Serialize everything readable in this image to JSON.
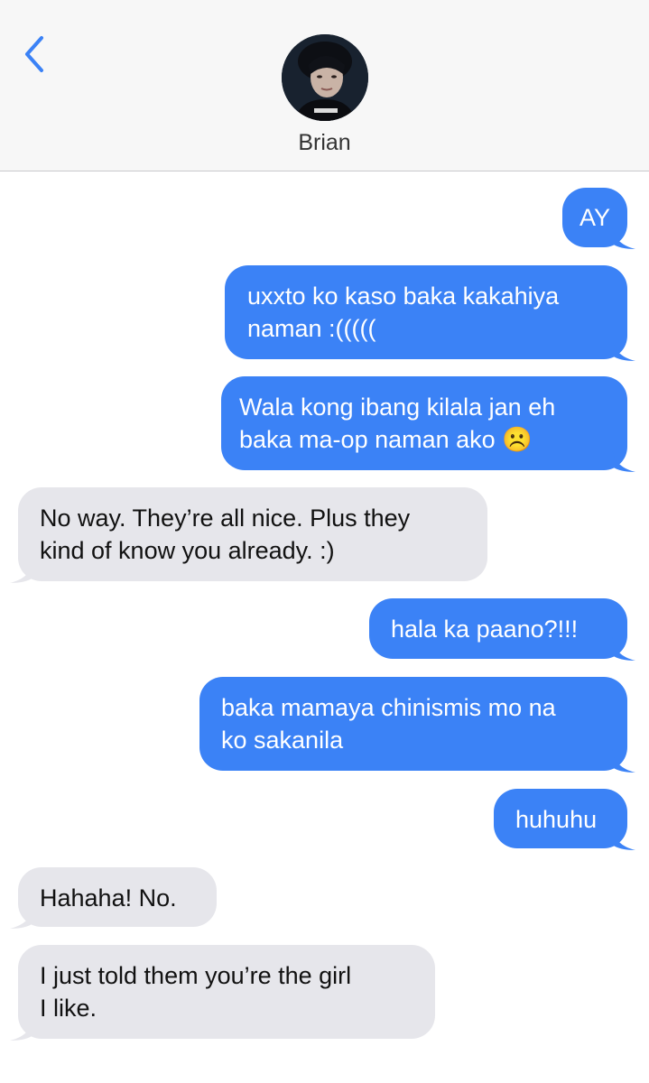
{
  "header": {
    "back_icon": "chevron-left-icon",
    "contact_name": "Brian",
    "avatar_icon": "contact-photo"
  },
  "colors": {
    "sent_bubble": "#3b82f6",
    "received_bubble": "#e6e6eb",
    "accent": "#3b82f6"
  },
  "messages": [
    {
      "direction": "sent",
      "lines": [
        "AY"
      ]
    },
    {
      "direction": "sent",
      "lines": [
        "uxxto ko kaso baka kakahiya",
        "naman :((((("
      ]
    },
    {
      "direction": "sent",
      "lines": [
        "Wala kong ibang kilala jan eh",
        "baka ma-op naman ako ☹️"
      ]
    },
    {
      "direction": "received",
      "lines": [
        "No way. They’re all nice. Plus they",
        "kind of know you already. :)"
      ]
    },
    {
      "direction": "sent",
      "lines": [
        "hala ka paano?!!!"
      ]
    },
    {
      "direction": "sent",
      "lines": [
        "baka mamaya chinismis mo na",
        "ko sakanila"
      ]
    },
    {
      "direction": "sent",
      "lines": [
        "huhuhu"
      ]
    },
    {
      "direction": "received",
      "lines": [
        "Hahaha! No."
      ]
    },
    {
      "direction": "received",
      "lines": [
        "I just told them you’re the girl",
        "I like."
      ]
    }
  ]
}
